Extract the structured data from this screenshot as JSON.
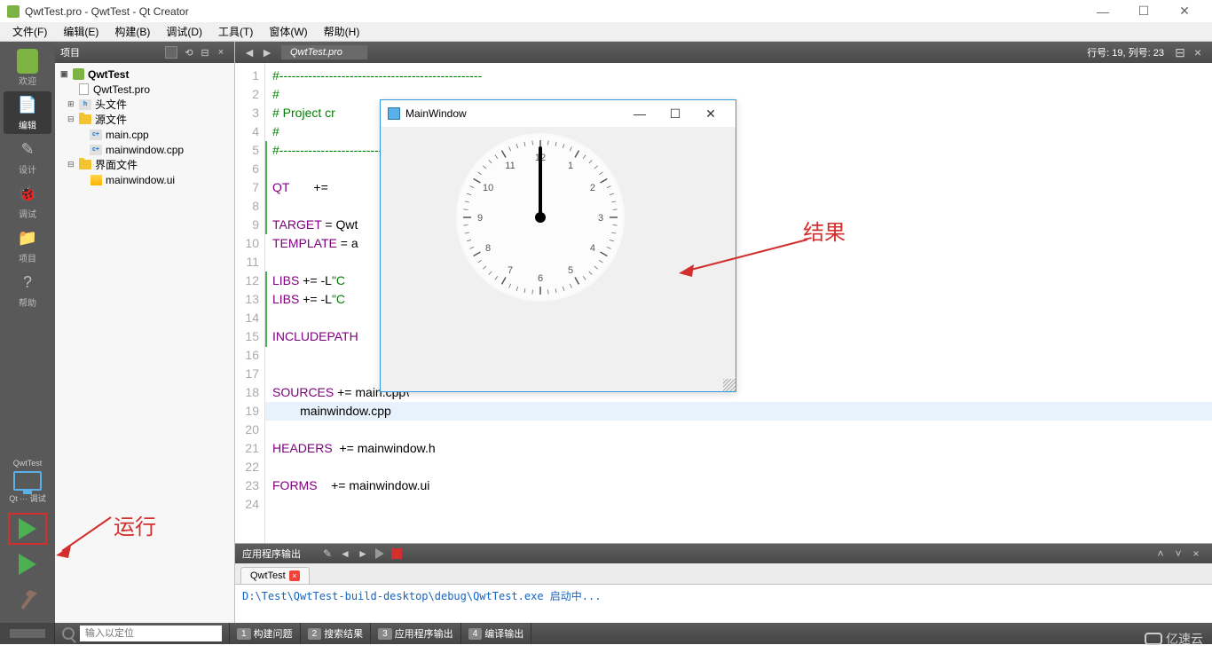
{
  "title": "QwtTest.pro - QwtTest - Qt Creator",
  "menus": [
    "文件(F)",
    "编辑(E)",
    "构建(B)",
    "调试(D)",
    "工具(T)",
    "窗体(W)",
    "帮助(H)"
  ],
  "left_modes": [
    {
      "label": "欢迎",
      "icon": "qt"
    },
    {
      "label": "编辑",
      "icon": "edit",
      "active": true
    },
    {
      "label": "设计",
      "icon": "design"
    },
    {
      "label": "调试",
      "icon": "debug"
    },
    {
      "label": "项目",
      "icon": "project"
    },
    {
      "label": "帮助",
      "icon": "help"
    }
  ],
  "left_project_label": "QwtTest",
  "left_config_label": "Qt ··· 调试",
  "project_pane": {
    "title": "项目",
    "tree": {
      "root": "QwtTest",
      "pro": "QwtTest.pro",
      "folders": [
        {
          "name": "头文件",
          "items": []
        },
        {
          "name": "源文件",
          "items": [
            "main.cpp",
            "mainwindow.cpp"
          ]
        },
        {
          "name": "界面文件",
          "items": [
            "mainwindow.ui"
          ]
        }
      ]
    }
  },
  "editor": {
    "file": "QwtTest.pro",
    "position_label": "行号: 19, 列号: 23",
    "lines": [
      {
        "n": 1,
        "t": "#-------------------------------------------------",
        "cls": "c-comment"
      },
      {
        "n": 2,
        "t": "#",
        "cls": "c-comment"
      },
      {
        "n": 3,
        "t": "# Project cr                                       07",
        "cls": "c-comment"
      },
      {
        "n": 4,
        "t": "#",
        "cls": "c-comment"
      },
      {
        "n": 5,
        "t": "#-------------------------------------------------",
        "cls": "c-comment"
      },
      {
        "n": 6,
        "t": "",
        "cls": ""
      },
      {
        "n": 7,
        "t": "QT       +=                                        ",
        "cls": "c-key"
      },
      {
        "n": 8,
        "t": "",
        "cls": ""
      },
      {
        "n": 9,
        "t": "TARGET = Qwt",
        "cls": "mixed-target"
      },
      {
        "n": 10,
        "t": "TEMPLATE = a",
        "cls": "mixed-template"
      },
      {
        "n": 11,
        "t": "",
        "cls": ""
      },
      {
        "n": 12,
        "t": "LIBS += -L\"C                                       w\\lib\" -lqwt613d",
        "cls": "mixed-libs"
      },
      {
        "n": 13,
        "t": "LIBS += -L\"C                                       w\\lib\" -lqwt613",
        "cls": "mixed-libs"
      },
      {
        "n": 14,
        "t": "",
        "cls": ""
      },
      {
        "n": 15,
        "t": "INCLUDEPATH                                        \\mingw\\include\\Qwt\"",
        "cls": "mixed-inc"
      },
      {
        "n": 16,
        "t": "",
        "cls": ""
      },
      {
        "n": 17,
        "t": "",
        "cls": ""
      },
      {
        "n": 18,
        "t": "SOURCES += main.cpp\\",
        "cls": "mixed-src"
      },
      {
        "n": 19,
        "t": "        mainwindow.cpp",
        "cls": "cursor"
      },
      {
        "n": 20,
        "t": "",
        "cls": ""
      },
      {
        "n": 21,
        "t": "HEADERS  += mainwindow.h",
        "cls": "mixed-hdr"
      },
      {
        "n": 22,
        "t": "",
        "cls": ""
      },
      {
        "n": 23,
        "t": "FORMS    += mainwindow.ui",
        "cls": "mixed-frm"
      },
      {
        "n": 24,
        "t": "",
        "cls": ""
      }
    ]
  },
  "output": {
    "header": "应用程序输出",
    "tab": "QwtTest",
    "body": "D:\\Test\\QwtTest-build-desktop\\debug\\QwtTest.exe 启动中..."
  },
  "statusbar": {
    "search_placeholder": "输入以定位",
    "panes": [
      "构建问题",
      "搜索结果",
      "应用程序输出",
      "编译输出"
    ]
  },
  "popup": {
    "title": "MainWindow",
    "clock_numbers": [
      "12",
      "1",
      "2",
      "3",
      "4",
      "5",
      "6",
      "7",
      "8",
      "9",
      "10",
      "11"
    ]
  },
  "annotations": {
    "result": "结果",
    "run": "运行"
  },
  "watermark": "亿速云"
}
